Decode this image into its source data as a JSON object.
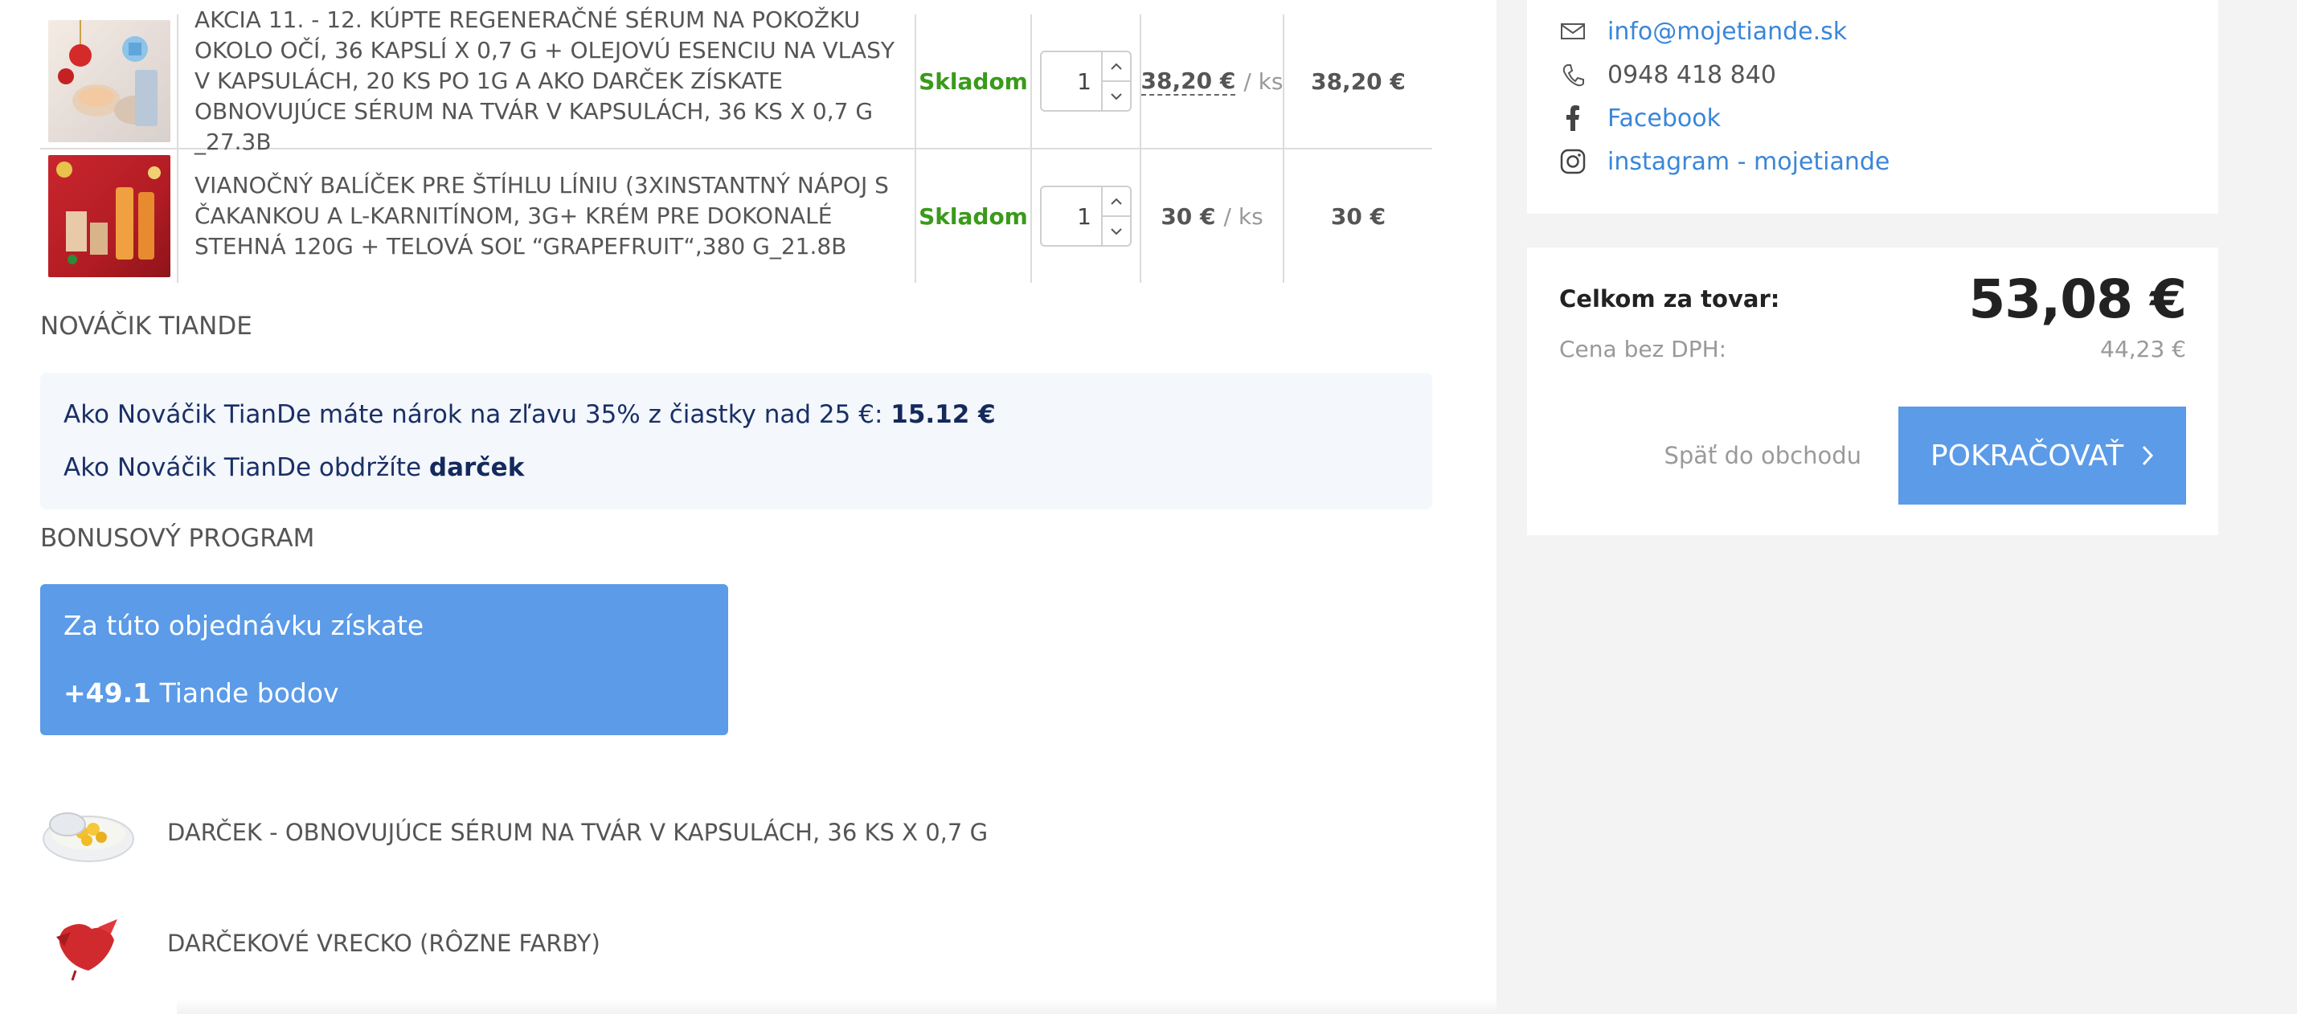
{
  "cart": {
    "items": [
      {
        "name": "AKCIA 11. - 12. KÚPTE REGENERAČNÉ SÉRUM NA POKOŽKU OKOLO OČÍ, 36 KAPSLÍ X 0,7 G + OLEJOVÚ ESENCIU NA VLASY V KAPSULÁCH, 20 KS PO 1G A AKO DARČEK ZÍSKATE OBNOVUJÚCE SÉRUM NA TVÁR V KAPSULÁCH, 36 KS X 0,7 G _27.3B",
        "stock": "Skladom",
        "qty": "1",
        "unit_price": "38,20 €",
        "per_unit": "/ ks",
        "total": "38,20 €"
      },
      {
        "name": "VIANOČNÝ BALÍČEK PRE ŠTÍHLU LÍNIU (3XINSTANTNÝ NÁPOJ S ČAKANKOU A L-KARNITÍNOM, 3G+ KRÉM PRE DOKONALÉ STEHNÁ 120G + TELOVÁ SOĽ “GRAPEFRUIT“,380 G_21.8B",
        "stock": "Skladom",
        "qty": "1",
        "unit_price": "30 €",
        "per_unit": "/ ks",
        "total": "30 €"
      }
    ]
  },
  "novacik": {
    "title": "NOVÁČIK TIANDE",
    "line1_text": "Ako Nováčik TianDe máte nárok na zľavu 35% z čiastky nad 25 €: ",
    "line1_value": "15.12 €",
    "line2_text": "Ako Nováčik TianDe obdržíte ",
    "line2_value": "darček"
  },
  "bonus": {
    "title": "BONUSOVÝ PROGRAM",
    "line1": "Za túto objednávku získate",
    "points": "+49.1",
    "points_label": " Tiande bodov"
  },
  "gifts": [
    {
      "label": "DARČEK - OBNOVUJÚCE SÉRUM NA TVÁR V KAPSULÁCH, 36 KS X 0,7 G"
    },
    {
      "label": "DARČEKOVÉ VRECKO (RÔZNE FARBY)"
    }
  ],
  "contact": {
    "email": "info@mojetiande.sk",
    "phone": "0948 418 840",
    "facebook": "Facebook",
    "instagram": "instagram - mojetiande",
    "icons": [
      "mail-icon",
      "phone-icon",
      "facebook-icon",
      "instagram-icon"
    ]
  },
  "summary": {
    "total_label": "Celkom za tovar:",
    "total_value": "53,08 €",
    "net_label": "Cena bez DPH:",
    "net_value": "44,23 €",
    "back_label": "Späť do obchodu",
    "continue_label": "POKRAČOVAŤ"
  },
  "colors": {
    "accent": "#5b9be8",
    "stock_green": "#3a9a1a",
    "link_blue": "#3a86d8",
    "novacik_bg": "#f4f7fb",
    "sidebar_bg": "#f3f3f3"
  }
}
